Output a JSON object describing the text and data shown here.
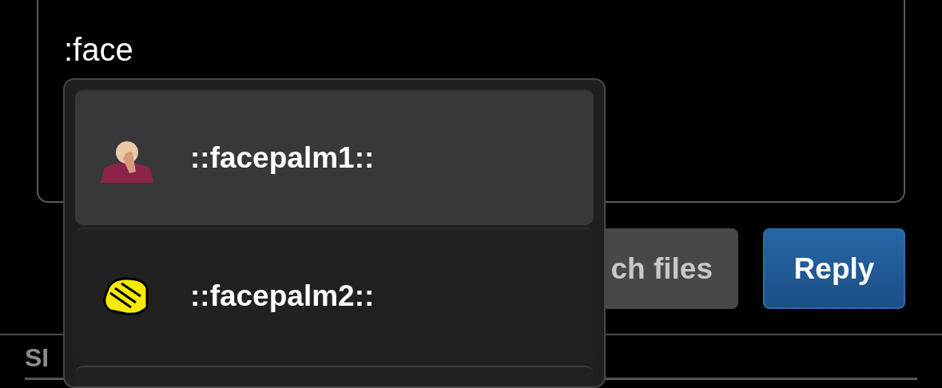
{
  "editor": {
    "value": ":face"
  },
  "buttons": [
    {
      "label": "ch files",
      "kind": "secondary"
    },
    {
      "label": "Reply",
      "kind": "primary"
    }
  ],
  "tabs": [
    {
      "label": "SI",
      "selected": true
    }
  ],
  "suggestions": [
    {
      "label": "::facepalm1::",
      "kind": "figure",
      "selected": true
    },
    {
      "label": "::facepalm2::",
      "kind": "hand",
      "selected": false
    }
  ]
}
